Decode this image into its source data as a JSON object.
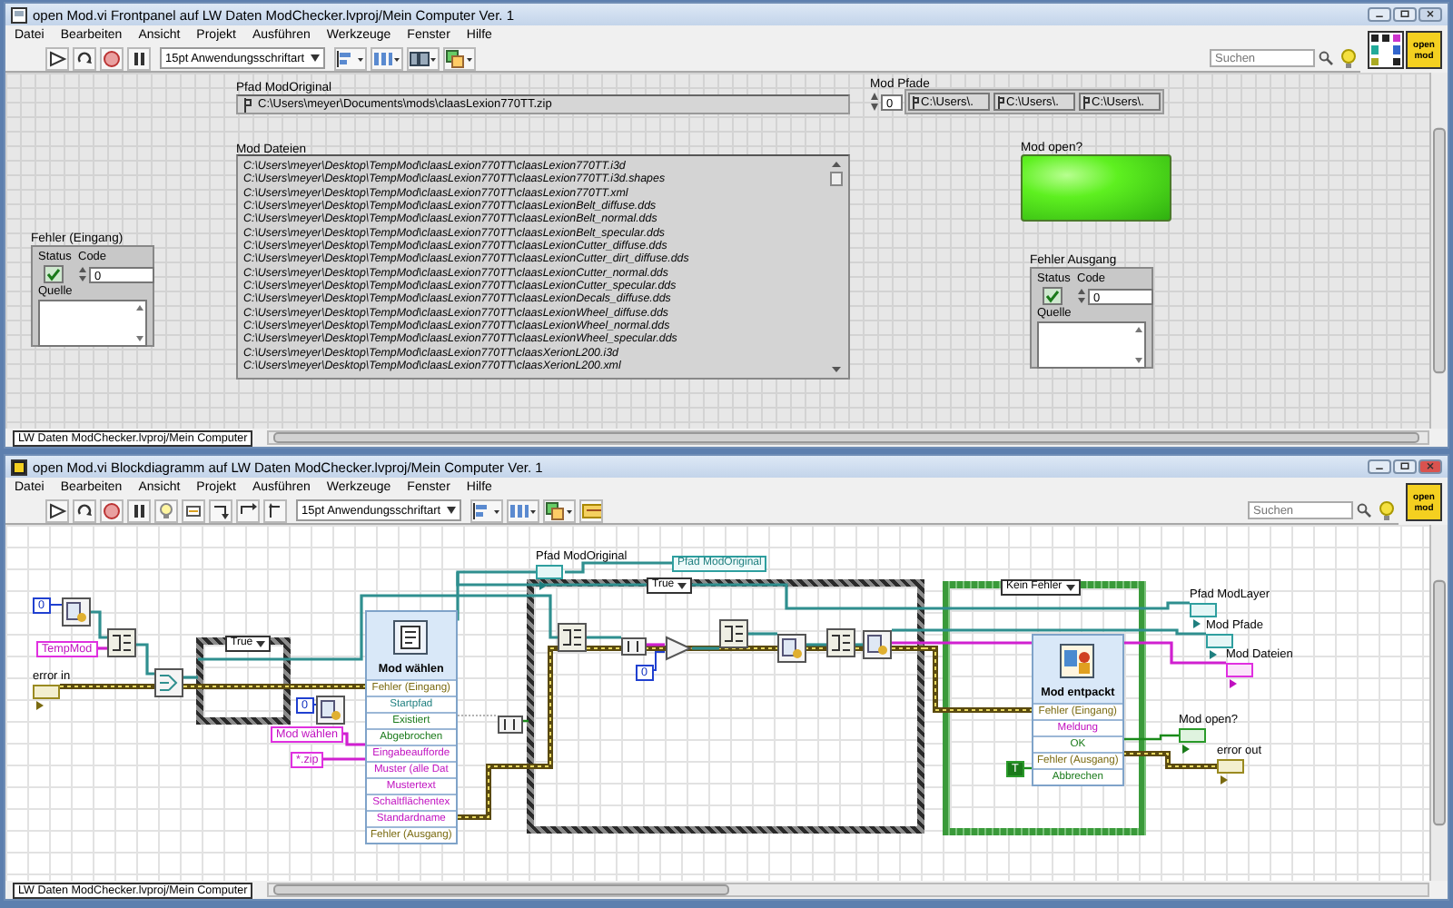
{
  "front_panel": {
    "window_title": "open Mod.vi Frontpanel auf LW Daten ModChecker.lvproj/Mein Computer Ver. 1",
    "menu": [
      "Datei",
      "Bearbeiten",
      "Ansicht",
      "Projekt",
      "Ausführen",
      "Werkzeuge",
      "Fenster",
      "Hilfe"
    ],
    "font_selector": "15pt Anwendungsschriftart",
    "search": {
      "placeholder": "Suchen"
    },
    "vi_icon": "open mod",
    "path_original": {
      "label": "Pfad ModOriginal",
      "value": "C:\\Users\\meyer\\Documents\\mods\\claasLexion770TT.zip"
    },
    "mod_files": {
      "label": "Mod Dateien",
      "items": [
        "C:\\Users\\meyer\\Desktop\\TempMod\\claasLexion770TT\\claasLexion770TT.i3d",
        "C:\\Users\\meyer\\Desktop\\TempMod\\claasLexion770TT\\claasLexion770TT.i3d.shapes",
        "C:\\Users\\meyer\\Desktop\\TempMod\\claasLexion770TT\\claasLexion770TT.xml",
        "C:\\Users\\meyer\\Desktop\\TempMod\\claasLexion770TT\\claasLexionBelt_diffuse.dds",
        "C:\\Users\\meyer\\Desktop\\TempMod\\claasLexion770TT\\claasLexionBelt_normal.dds",
        "C:\\Users\\meyer\\Desktop\\TempMod\\claasLexion770TT\\claasLexionBelt_specular.dds",
        "C:\\Users\\meyer\\Desktop\\TempMod\\claasLexion770TT\\claasLexionCutter_diffuse.dds",
        "C:\\Users\\meyer\\Desktop\\TempMod\\claasLexion770TT\\claasLexionCutter_dirt_diffuse.dds",
        "C:\\Users\\meyer\\Desktop\\TempMod\\claasLexion770TT\\claasLexionCutter_normal.dds",
        "C:\\Users\\meyer\\Desktop\\TempMod\\claasLexion770TT\\claasLexionCutter_specular.dds",
        "C:\\Users\\meyer\\Desktop\\TempMod\\claasLexion770TT\\claasLexionDecals_diffuse.dds",
        "C:\\Users\\meyer\\Desktop\\TempMod\\claasLexion770TT\\claasLexionWheel_diffuse.dds",
        "C:\\Users\\meyer\\Desktop\\TempMod\\claasLexion770TT\\claasLexionWheel_normal.dds",
        "C:\\Users\\meyer\\Desktop\\TempMod\\claasLexion770TT\\claasLexionWheel_specular.dds",
        "C:\\Users\\meyer\\Desktop\\TempMod\\claasLexion770TT\\claasXerionL200.i3d",
        "C:\\Users\\meyer\\Desktop\\TempMod\\claasLexion770TT\\claasXerionL200.xml"
      ]
    },
    "mod_paths": {
      "label": "Mod Pfade",
      "index": "0",
      "elements": [
        "C:\\Users\\.",
        "C:\\Users\\.",
        "C:\\Users\\."
      ]
    },
    "mod_open": {
      "label": "Mod open?",
      "on": true
    },
    "error_in": {
      "label": "Fehler (Eingang)",
      "status_label": "Status",
      "code_label": "Code",
      "code": "0",
      "source_label": "Quelle"
    },
    "error_out": {
      "label": "Fehler Ausgang",
      "status_label": "Status",
      "code_label": "Code",
      "code": "0",
      "source_label": "Quelle"
    },
    "status_bar": "LW Daten ModChecker.lvproj/Mein Computer"
  },
  "block_diagram": {
    "window_title": "open Mod.vi Blockdiagramm auf LW Daten ModChecker.lvproj/Mein Computer Ver. 1",
    "menu": [
      "Datei",
      "Bearbeiten",
      "Ansicht",
      "Projekt",
      "Ausführen",
      "Werkzeuge",
      "Fenster",
      "Hilfe"
    ],
    "font_selector": "15pt Anwendungsschriftart",
    "search": {
      "placeholder": "Suchen"
    },
    "vi_icon": "open mod",
    "case_structures": [
      {
        "kind": "boolean",
        "selector": "True"
      },
      {
        "kind": "boolean",
        "selector": "True"
      },
      {
        "kind": "error",
        "selector": "Kein Fehler"
      }
    ],
    "constants": [
      {
        "kind": "numeric",
        "value": "0"
      },
      {
        "kind": "string",
        "value": "TempMod"
      },
      {
        "kind": "numeric",
        "value": "0"
      },
      {
        "kind": "string",
        "value": "Mod wählen"
      },
      {
        "kind": "string",
        "value": "*.zip"
      },
      {
        "kind": "numeric",
        "value": "0"
      },
      {
        "kind": "boolean",
        "value": "T"
      }
    ],
    "terminals": [
      {
        "kind": "error",
        "label": "error in"
      },
      {
        "kind": "path",
        "label": "Pfad ModOriginal"
      },
      {
        "kind": "path",
        "label": "Pfad ModLayer"
      },
      {
        "kind": "path",
        "label": "Mod Pfade"
      },
      {
        "kind": "string",
        "label": "Mod Dateien"
      },
      {
        "kind": "boolean",
        "label": "Mod open?"
      },
      {
        "kind": "error",
        "label": "error out"
      }
    ],
    "local_variable": {
      "label": "Pfad ModOriginal"
    },
    "express_nodes": [
      {
        "title": "Mod wählen",
        "rows": [
          {
            "kind": "error",
            "label": "Fehler (Eingang)"
          },
          {
            "kind": "path",
            "label": "Startpfad"
          },
          {
            "kind": "boolean",
            "label": "Existiert"
          },
          {
            "kind": "boolean",
            "label": "Abgebrochen"
          },
          {
            "kind": "string",
            "label": "Eingabeaufforde"
          },
          {
            "kind": "string",
            "label": "Muster (alle Dat"
          },
          {
            "kind": "string",
            "label": "Mustertext"
          },
          {
            "kind": "string",
            "label": "Schaltflächentex"
          },
          {
            "kind": "string",
            "label": "Standardname"
          },
          {
            "kind": "error",
            "label": "Fehler (Ausgang)"
          }
        ]
      },
      {
        "title": "Mod entpackt",
        "rows": [
          {
            "kind": "error",
            "label": "Fehler (Eingang)"
          },
          {
            "kind": "string",
            "label": "Meldung"
          },
          {
            "kind": "boolean",
            "label": "OK"
          },
          {
            "kind": "error",
            "label": "Fehler (Ausgang)"
          },
          {
            "kind": "boolean",
            "label": "Abbrechen"
          }
        ]
      }
    ],
    "status_bar": "LW Daten ModChecker.lvproj/Mein Computer"
  }
}
